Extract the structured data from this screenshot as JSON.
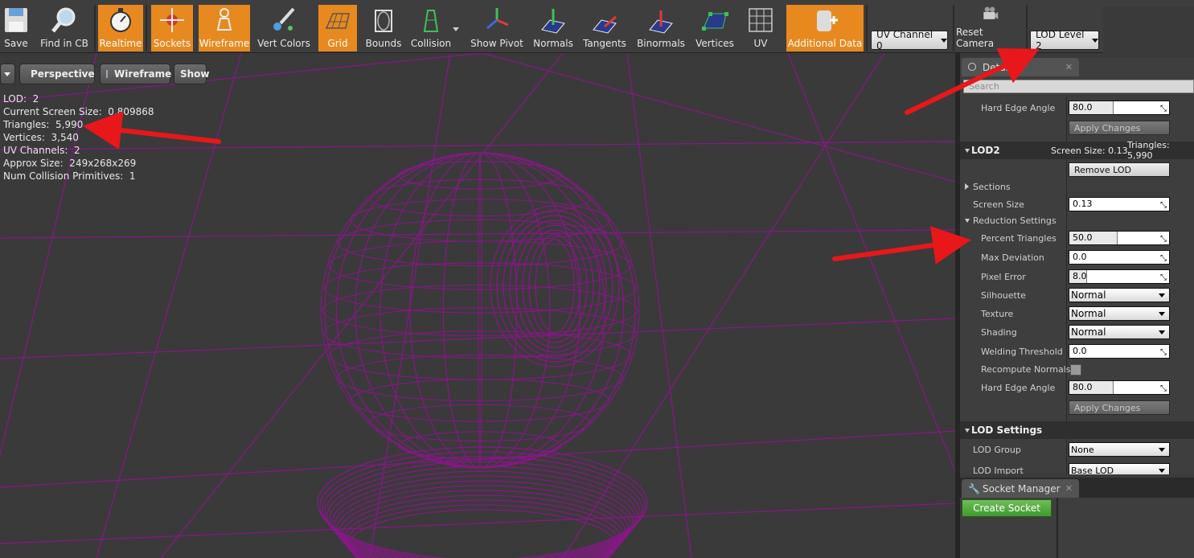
{
  "toolbar": {
    "save": "Save",
    "find_in_cb": "Find in CB",
    "realtime": "Realtime",
    "sockets": "Sockets",
    "wireframe": "Wireframe",
    "vert_colors": "Vert Colors",
    "grid": "Grid",
    "bounds": "Bounds",
    "collision": "Collision",
    "show_pivot": "Show Pivot",
    "normals": "Normals",
    "tangents": "Tangents",
    "binormals": "Binormals",
    "vertices": "Vertices",
    "uv": "UV",
    "additional_data": "Additional Data",
    "uv_channel": "UV Channel 0",
    "reset_camera": "Reset Camera",
    "lod_level": "LOD Level 2",
    "accent_color": "#e8891f"
  },
  "viewport": {
    "perspective_label": "Perspective",
    "wireframe_label": "Wireframe",
    "show_label": "Show",
    "wire_color": "#8a168a",
    "stats": [
      {
        "label": "LOD:",
        "value": "2"
      },
      {
        "label": "Current Screen Size:",
        "value": "0.809868"
      },
      {
        "label": "Triangles:",
        "value": "5,990"
      },
      {
        "label": "Vertices:",
        "value": "3,540"
      },
      {
        "label": "UV Channels:",
        "value": "2"
      },
      {
        "label": "Approx Size:",
        "value": "249x268x269"
      },
      {
        "label": "Num Collision Primitives:",
        "value": "1"
      }
    ]
  },
  "details": {
    "tab_label": "Details",
    "search_placeholder": "Search",
    "top": {
      "hard_edge_label": "Hard Edge Angle",
      "hard_edge_value": "80.0",
      "apply_label": "Apply Changes"
    },
    "lod2": {
      "title": "LOD2",
      "screen_size_info": "Screen Size: 0.13",
      "triangles_info": "Triangles: 5,990",
      "remove_lod": "Remove LOD",
      "sections": "Sections",
      "screen_size_label": "Screen Size",
      "screen_size_value": "0.13",
      "reduction_settings": "Reduction Settings",
      "percent_triangles_label": "Percent Triangles",
      "percent_triangles_value": "50.0",
      "max_deviation_label": "Max Deviation",
      "max_deviation_value": "0.0",
      "pixel_error_label": "Pixel Error",
      "pixel_error_value": "8.0",
      "silhouette_label": "Silhouette",
      "silhouette_value": "Normal",
      "texture_label": "Texture",
      "texture_value": "Normal",
      "shading_label": "Shading",
      "shading_value": "Normal",
      "welding_label": "Welding Threshold",
      "welding_value": "0.0",
      "recompute_label": "Recompute Normals",
      "recompute_checked": false,
      "hard_edge_label": "Hard Edge Angle",
      "hard_edge_value": "80.0",
      "apply_label": "Apply Changes"
    },
    "lod_settings": {
      "title": "LOD Settings",
      "lod_group_label": "LOD Group",
      "lod_group_value": "None",
      "lod_import_label": "LOD Import",
      "lod_import_value": "Base LOD"
    }
  },
  "socket_manager": {
    "tab_label": "Socket Manager",
    "create_socket": "Create Socket"
  }
}
